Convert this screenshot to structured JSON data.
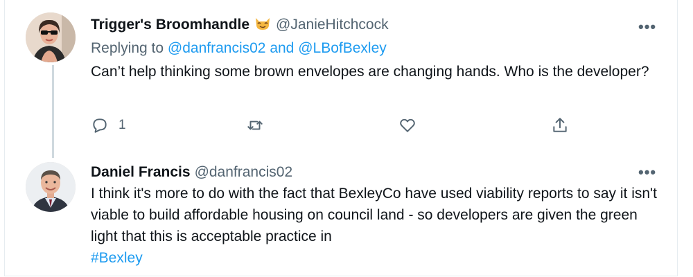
{
  "tweets": [
    {
      "author_name": "Trigger's Broomhandle",
      "author_handle": "@JanieHitchcock",
      "replying_label": "Replying to",
      "replying_to": [
        "@danfrancis02",
        "@LBofBexley"
      ],
      "replying_and": "and",
      "text": "Can’t help thinking some brown envelopes are changing hands.  Who is the developer?",
      "reply_count": "1",
      "avatar_icon": "woman-with-sunglasses-avatar",
      "emoji_icon": "cat-face-emoji"
    },
    {
      "author_name": "Daniel Francis",
      "author_handle": "@danfrancis02",
      "text": "I think it's more to do with the fact that BexleyCo have used viability reports to say it isn't viable to build affordable housing on council land - so developers are given the green light that this is acceptable practice in",
      "hashtag": "#Bexley",
      "avatar_icon": "man-in-suit-avatar"
    }
  ],
  "more_label": "•••",
  "colors": {
    "link": "#1d9bf0",
    "secondary_text": "#536471",
    "primary_text": "#0f1419",
    "thread_line": "#cfd9de"
  }
}
